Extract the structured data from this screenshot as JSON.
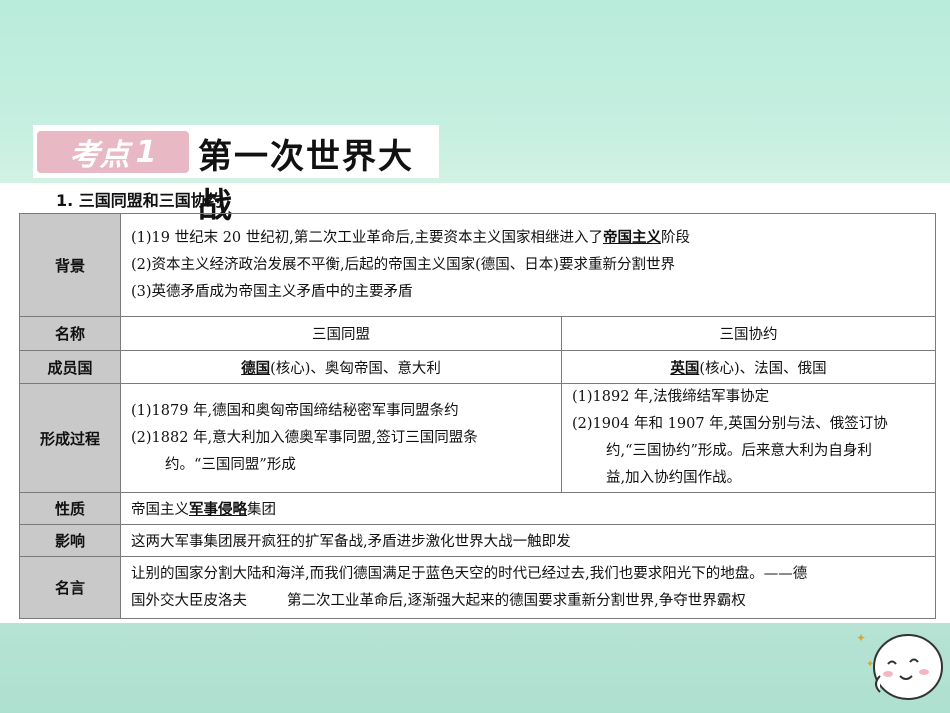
{
  "header": {
    "badge_text": "考点",
    "badge_num": "1",
    "title": "第一次世界大战"
  },
  "section": {
    "subtitle": "1. 三国同盟和三国协约"
  },
  "table": {
    "background": {
      "label": "背景",
      "line1_pre": "(1)19 世纪末 20 世纪初,第二次工业革命后,主要资本主义国家相继进入了",
      "line1_key": "帝国主义",
      "line1_post": "阶段",
      "line2": "(2)资本主义经济政治发展不平衡,后起的帝国主义国家(德国、日本)要求重新分割世界",
      "line3": "(3)英德矛盾成为帝国主义矛盾中的主要矛盾"
    },
    "name_row": {
      "label": "名称",
      "left": "三国同盟",
      "right": "三国协约"
    },
    "members": {
      "label": "成员国",
      "left_key": "德国",
      "left_rest": "(核心)、奥匈帝国、意大利",
      "right_key": "英国",
      "right_rest": "(核心)、法国、俄国"
    },
    "formation": {
      "label": "形成过程",
      "left_line1": "(1)1879 年,德国和奥匈帝国缔结秘密军事同盟条约",
      "left_line2": "(2)1882 年,意大利加入德奥军事同盟,签订三国同盟条",
      "left_line3": "约。“三国同盟”形成",
      "right_line1": "(1)1892 年,法俄缔结军事协定",
      "right_line2": "(2)1904 年和 1907 年,英国分别与法、俄签订协",
      "right_line3": "约,“三国协约”形成。后来意大利为自身利",
      "right_line4": "益,加入协约国作战。"
    },
    "nature": {
      "label": "性质",
      "pre": "帝国主义",
      "key": "军事侵略",
      "post": "集团"
    },
    "impact": {
      "label": "影响",
      "text": "这两大军事集团展开疯狂的扩军备战,矛盾进步激化世界大战一触即发"
    },
    "quote": {
      "label": "名言",
      "line1": "让别的国家分割大陆和海洋,而我们德国满足于蓝色天空的时代已经过去,我们也要求阳光下的地盘。——德",
      "line2_a": "国外交大臣皮洛夫",
      "line2_b": "第二次工业革命后,逐渐强大起来的德国要求重新分割世界,争夺世界霸权"
    }
  },
  "colors": {
    "badge": "#e8b9c4",
    "header_cell": "#c9c9c9"
  },
  "icons": {
    "mascot": "cartoon-face-icon"
  }
}
